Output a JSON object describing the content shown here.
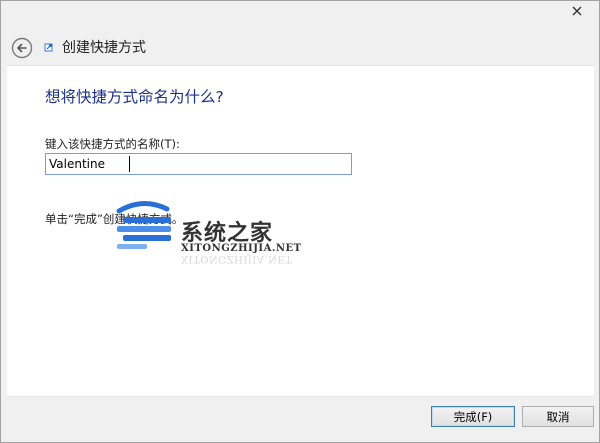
{
  "window": {
    "close_icon": "close-icon"
  },
  "nav": {
    "back_icon": "back-arrow-icon",
    "title_icon": "shortcut-icon",
    "title": "创建快捷方式"
  },
  "main": {
    "heading": "想将快捷方式命名为什么?",
    "name_label": "键入该快捷方式的名称(T):",
    "name_value": "Valentine",
    "hint": "单击“完成”创建快捷方式。"
  },
  "watermark": {
    "title": "系统之家",
    "url": "XITONGZHIJIA.NET"
  },
  "footer": {
    "finish_label": "完成(F)",
    "cancel_label": "取消"
  },
  "colors": {
    "heading": "#1e3287",
    "input_border": "#7a9fd5",
    "watermark_blue": "#2a6fd6"
  }
}
